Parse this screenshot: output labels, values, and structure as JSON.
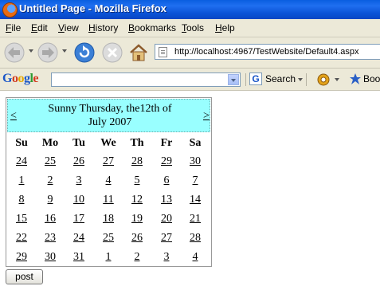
{
  "window": {
    "title": "Untitled Page - Mozilla Firefox"
  },
  "menu": [
    "File",
    "Edit",
    "View",
    "History",
    "Bookmarks",
    "Tools",
    "Help"
  ],
  "navigation": {
    "url": "http://localhost:4967/TestWebsite/Default4.aspx"
  },
  "google_toolbar": {
    "logo": "Google",
    "search_label": "Search",
    "bookmarks_label": "Book"
  },
  "calendar": {
    "prev": "<",
    "next": ">",
    "caption_line1": "Sunny Thursday, the12th of",
    "caption_line2": "July 2007",
    "days_of_week": [
      "Su",
      "Mo",
      "Tu",
      "We",
      "Th",
      "Fr",
      "Sa"
    ],
    "weeks": [
      [
        "24",
        "25",
        "26",
        "27",
        "28",
        "29",
        "30"
      ],
      [
        "1",
        "2",
        "3",
        "4",
        "5",
        "6",
        "7"
      ],
      [
        "8",
        "9",
        "10",
        "11",
        "12",
        "13",
        "14"
      ],
      [
        "15",
        "16",
        "17",
        "18",
        "19",
        "20",
        "21"
      ],
      [
        "22",
        "23",
        "24",
        "25",
        "26",
        "27",
        "28"
      ],
      [
        "29",
        "30",
        "31",
        "1",
        "2",
        "3",
        "4"
      ]
    ]
  },
  "form": {
    "post_label": "post"
  },
  "colors": {
    "calendar_header": "#99ffff",
    "titlebar": "#0a52d6"
  }
}
